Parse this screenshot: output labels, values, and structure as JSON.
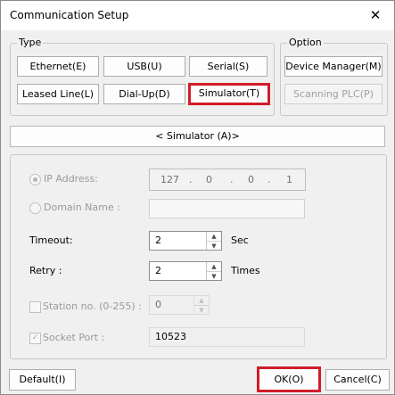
{
  "window": {
    "title": "Communication Setup",
    "close_glyph": "✕"
  },
  "type_group": {
    "legend": "Type",
    "buttons": [
      "Ethernet(E)",
      "USB(U)",
      "Serial(S)",
      "Leased Line(L)",
      "Dial-Up(D)",
      "Simulator(T)"
    ]
  },
  "option_group": {
    "legend": "Option",
    "buttons": [
      "Device Manager(M)",
      "Scanning PLC(P)"
    ]
  },
  "header_bar": {
    "text": "< Simulator (A)>"
  },
  "form": {
    "ip_label": "IP Address:",
    "ip_octets": [
      "127",
      "0",
      "0",
      "1"
    ],
    "domain_label": "Domain Name :",
    "timeout_label": "Timeout:",
    "timeout_value": "2",
    "timeout_unit": "Sec",
    "retry_label": "Retry :",
    "retry_value": "2",
    "retry_unit": "Times",
    "station_label": "Station no. (0-255) :",
    "station_value": "0",
    "socket_label": "Socket Port :",
    "socket_value": "10523"
  },
  "footer": {
    "default_label": "Default(I)",
    "ok_label": "OK(O)",
    "cancel_label": "Cancel(C)"
  },
  "colors": {
    "highlight": "#d11d2a",
    "background": "#f0f0f0"
  }
}
